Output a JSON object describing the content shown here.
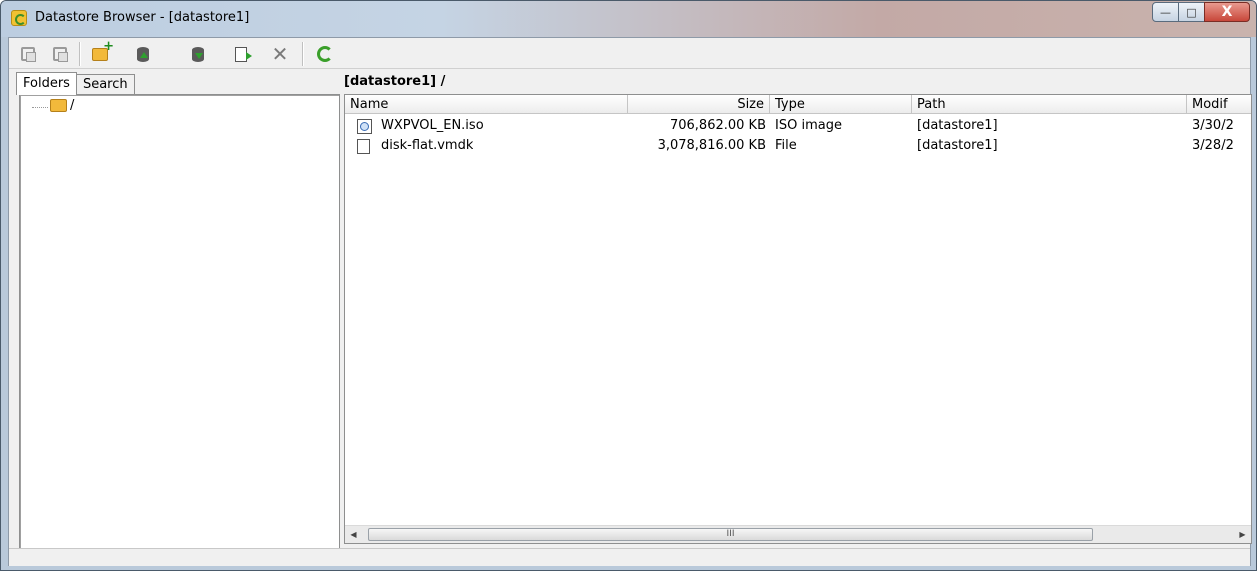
{
  "window": {
    "title": "Datastore Browser - [datastore1]",
    "controls": {
      "minimize": "—",
      "maximize": "□",
      "close": "X"
    }
  },
  "toolbar": {
    "buttons": [
      {
        "name": "copy",
        "icon": "copy-icon"
      },
      {
        "name": "paste",
        "icon": "paste-icon"
      },
      {
        "name": "new-folder",
        "icon": "new-folder-icon"
      },
      {
        "name": "upload",
        "icon": "upload-icon"
      },
      {
        "name": "download",
        "icon": "download-icon"
      },
      {
        "name": "move",
        "icon": "move-icon"
      },
      {
        "name": "delete",
        "icon": "delete-icon",
        "glyph": "✕"
      },
      {
        "name": "refresh",
        "icon": "refresh-icon"
      }
    ]
  },
  "left": {
    "tabs": [
      {
        "label": "Folders",
        "active": true
      },
      {
        "label": "Search",
        "active": false
      }
    ],
    "tree": [
      {
        "label": "/"
      }
    ]
  },
  "right": {
    "path": "[datastore1] /",
    "columns": {
      "name": "Name",
      "size": "Size",
      "type": "Type",
      "path": "Path",
      "modified": "Modif"
    },
    "rows": [
      {
        "icon": "iso-image-icon",
        "name": "WXPVOL_EN.iso",
        "size": "706,862.00 KB",
        "type": "ISO image",
        "path": "[datastore1]",
        "modified": "3/30/2"
      },
      {
        "icon": "file-icon",
        "name": "disk-flat.vmdk",
        "size": "3,078,816.00 KB",
        "type": "File",
        "path": "[datastore1]",
        "modified": "3/28/2"
      }
    ],
    "scrollbar": {
      "thumb_grip": "III"
    }
  },
  "colors": {
    "accent_green": "#3a9f2a",
    "folder_yellow": "#f2b93b",
    "close_red": "#c8473a"
  }
}
